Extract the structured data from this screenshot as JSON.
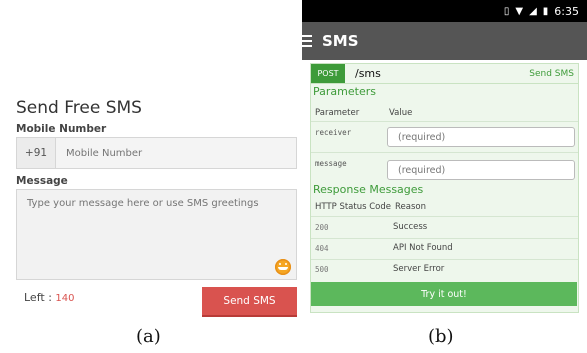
{
  "panel_a": {
    "title": "Send Free SMS",
    "mobile_label": "Mobile Number",
    "country_code": "+91",
    "mobile_placeholder": "Mobile Number",
    "message_label": "Message",
    "message_placeholder": "Type your message here or use SMS greetings",
    "emoji_icon": "smiley-icon",
    "left_label": "Left :",
    "left_count": "140",
    "send_button": "Send SMS",
    "caption": "(a)"
  },
  "panel_b": {
    "status_time": "6:35",
    "app_title": "SMS",
    "method": "POST",
    "path": "/sms",
    "endpoint_link": "Send SMS",
    "parameters_title": "Parameters",
    "param_headers": [
      "Parameter",
      "Value"
    ],
    "params": [
      {
        "name": "receiver",
        "placeholder": "(required)"
      },
      {
        "name": "message",
        "placeholder": "(required)"
      }
    ],
    "response_title": "Response Messages",
    "response_headers": [
      "HTTP Status Code",
      "Reason"
    ],
    "responses": [
      {
        "code": "200",
        "reason": "Success"
      },
      {
        "code": "404",
        "reason": "API Not Found"
      },
      {
        "code": "500",
        "reason": "Server Error"
      }
    ],
    "try_button": "Try it out!",
    "caption": "(b)"
  },
  "colors": {
    "send_red": "#d9534f",
    "swagger_green": "#3e9b3a",
    "card_bg": "#eef7ec",
    "try_green": "#5cb85c",
    "appbar_gray": "#555555"
  }
}
